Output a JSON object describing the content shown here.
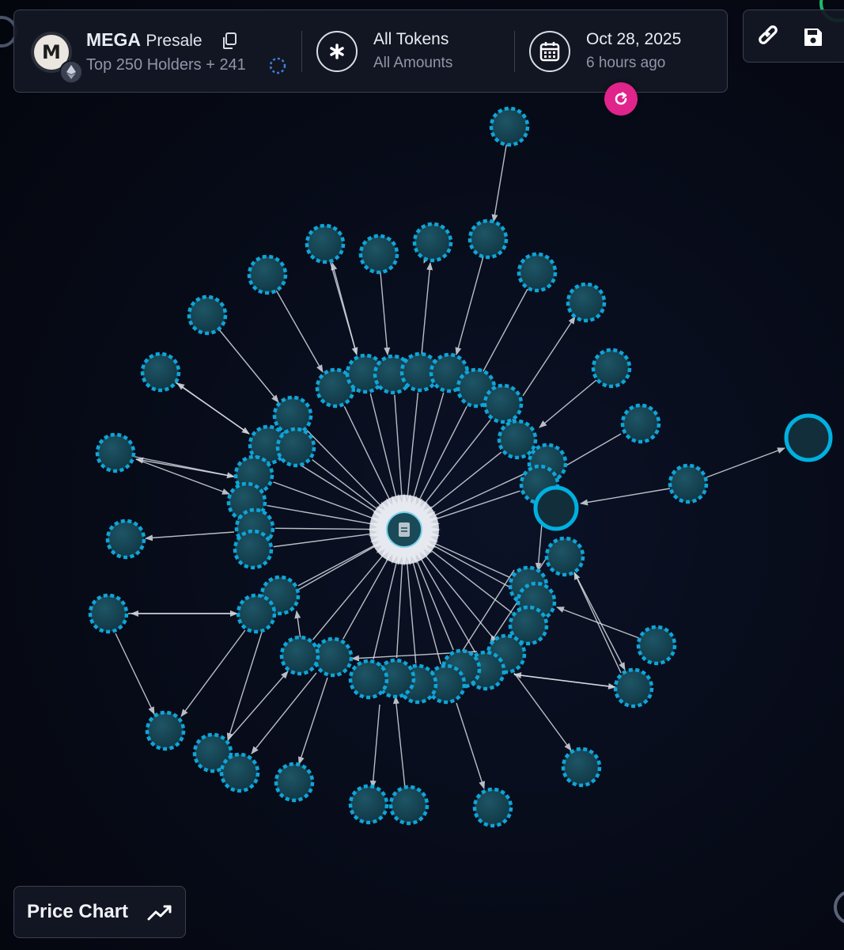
{
  "header": {
    "avatar_letter": "M",
    "token_symbol": "MEGA",
    "token_label": "Presale",
    "holders_text": "Top 250 Holders + 241",
    "chain_icon": "ethereum-icon",
    "tokens_selector": {
      "title": "All Tokens",
      "subtitle": "All Amounts",
      "icon": "asterisk-icon"
    },
    "date_selector": {
      "date": "Oct 28, 2025",
      "relative": "6 hours ago",
      "icon": "calendar-icon"
    }
  },
  "toolbar": {
    "link_icon": "link-icon",
    "save_icon": "save-icon",
    "refresh_icon": "refresh-icon"
  },
  "footer": {
    "price_chart_label": "Price Chart",
    "price_chart_icon": "trend-line-icon"
  },
  "colors": {
    "node_fill": "#15414e",
    "node_border": "#0fa5d8",
    "highlight_node": "#00b0e0",
    "edge": "#d7dce4",
    "accent_refresh": "#e0248c",
    "background": "#070b18"
  },
  "graph": {
    "center_node_icon": "document-icon",
    "node_count": 72
  }
}
